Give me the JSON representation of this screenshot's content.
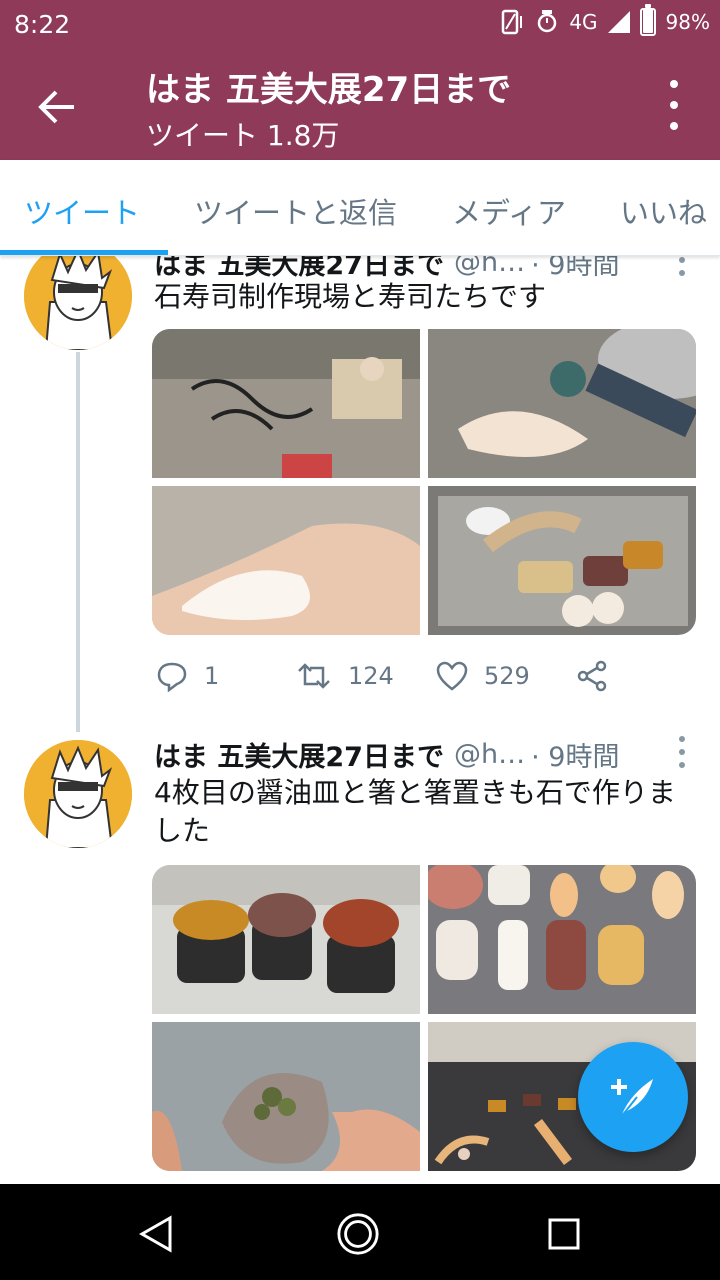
{
  "status_bar": {
    "time": "8:22",
    "network": "4G",
    "battery_percent": "98%",
    "battery_level": 0.98
  },
  "app_bar": {
    "title": "はま 五美大展27日まで",
    "subtitle": "ツイート 1.8万",
    "back_icon": "arrow-left-icon",
    "more_icon": "more-vertical-icon"
  },
  "tabs": [
    {
      "label": "ツイート",
      "active": true
    },
    {
      "label": "ツイートと返信",
      "active": false
    },
    {
      "label": "メディア",
      "active": false
    },
    {
      "label": "いいね",
      "active": false
    }
  ],
  "tweets": [
    {
      "name": "はま 五美大展27日まで",
      "handle": "@h…",
      "time": "· 9時間",
      "text": "石寿司制作現場と寿司たちです",
      "media_count": 4,
      "reply_count": "1",
      "retweet_count": "124",
      "like_count": "529"
    },
    {
      "name": "はま 五美大展27日まで",
      "handle": "@h…",
      "time": "· 9時間",
      "text": "4枚目の醤油皿と箸と箸置きも石で作りました",
      "media_count": 4
    }
  ],
  "fab": {
    "icon": "compose-tweet-icon"
  },
  "nav_bar": {
    "icons": [
      "back-triangle-icon",
      "home-circle-icon",
      "recents-square-icon"
    ]
  },
  "colors": {
    "header": "#8e3a58",
    "accent": "#1da1f2",
    "secondary_text": "#657786",
    "thread_line": "#ccd6dd"
  }
}
